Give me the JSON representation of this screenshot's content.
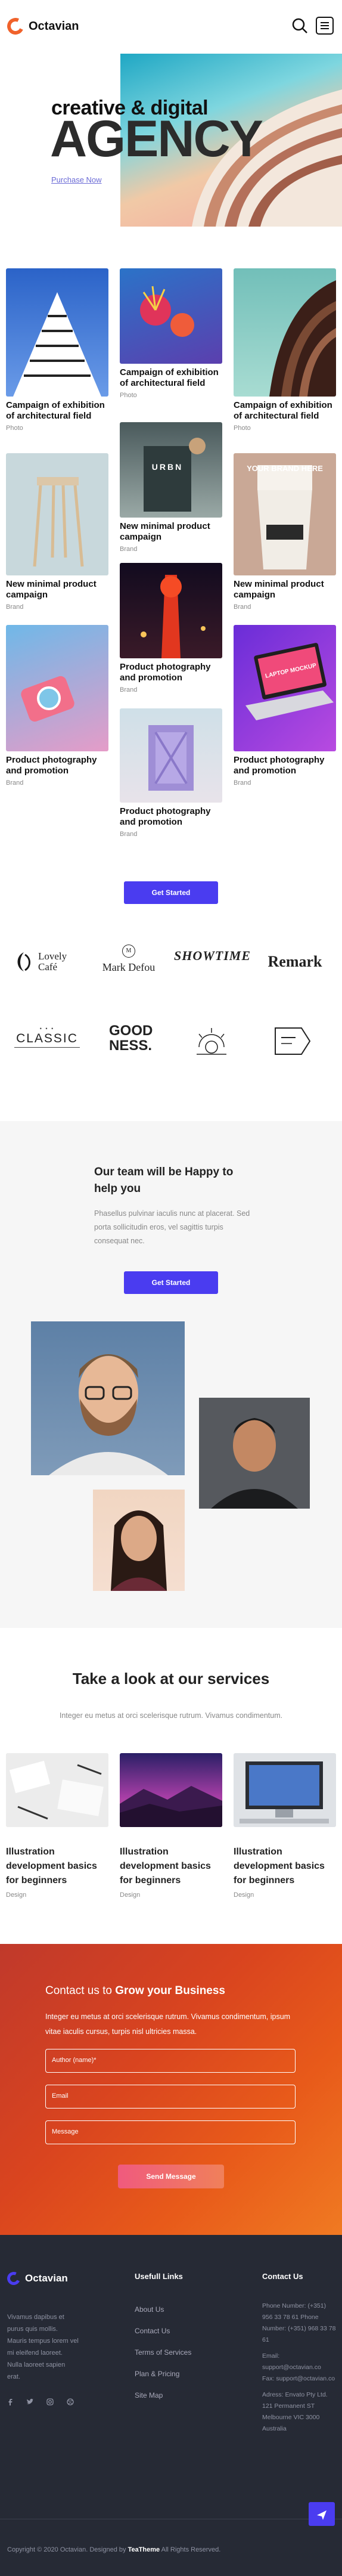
{
  "brand": {
    "name": "Octavian"
  },
  "hero": {
    "subtitle": "creative & digital",
    "title": "AGENCY",
    "link": "Purchase Now"
  },
  "portfolio": [
    {
      "title": "Campaign of exhibition of architectural field",
      "category": "Photo"
    },
    {
      "title": "Campaign of exhibition of architectural field",
      "category": "Photo"
    },
    {
      "title": "Campaign of exhibition of architectural field",
      "category": "Photo"
    },
    {
      "title": "New minimal product campaign",
      "category": "Brand"
    },
    {
      "title": "New minimal product campaign",
      "category": "Brand"
    },
    {
      "title": "New minimal product campaign",
      "category": "Brand"
    },
    {
      "title": "Product photography and promotion",
      "category": "Brand"
    },
    {
      "title": "Product photography and promotion",
      "category": "Brand"
    },
    {
      "title": "Product photography and promotion",
      "category": "Brand"
    },
    {
      "title": "Product photography and promotion",
      "category": "Brand"
    }
  ],
  "card_texts": {
    "urbn": "URBN",
    "your_brand": "YOUR BRAND HERE",
    "laptop": "LAPTOP MOCKUP"
  },
  "get_started": "Get Started",
  "brands": [
    "Lovely Café",
    "Mark Defou",
    "SHOWTIME",
    "Remark",
    "CLASSIC",
    "GOOD NESS.",
    "",
    ""
  ],
  "team": {
    "heading": "Our team will be Happy to help you",
    "text": "Phasellus pulvinar iaculis nunc at placerat. Sed porta sollicitudin eros, vel sagittis turpis consequat nec.",
    "button": "Get Started"
  },
  "services": {
    "heading": "Take a look at our services",
    "text": "Integer eu metus at orci scelerisque rutrum. Vivamus condimentum.",
    "items": [
      {
        "title": "Illustration development basics for beginners",
        "category": "Design"
      },
      {
        "title": "Illustration development basics for beginners",
        "category": "Design"
      },
      {
        "title": "Illustration development basics for beginners",
        "category": "Design"
      }
    ]
  },
  "contact": {
    "heading_pre": "Contact us to ",
    "heading_bold": "Grow your Business",
    "text": "Integer eu metus at orci scelerisque rutrum. Vivamus condimentum, ipsum vitae iaculis cursus, turpis nisl ultricies massa.",
    "author_placeholder": "Author (name)*",
    "email_placeholder": "Email",
    "message_placeholder": "Message",
    "send": "Send Message"
  },
  "footer": {
    "about": "Vivamus dapibus et purus quis mollis. Mauris tempus lorem vel mi eleifend laoreet. Nulla laoreet sapien erat.",
    "useful_title": "Usefull Links",
    "links": [
      "About Us",
      "Contact Us",
      "Terms of Services",
      "Plan & Pricing",
      "Site Map"
    ],
    "contact_title": "Contact Us",
    "contact_lines": [
      "Phone Number: (+351) 956 33 78 61 Phone Number: (+351) 968 33 78 61",
      "Email: support@octavian.co",
      "Fax: support@octavian.co",
      "Adress: Envato Pty Ltd. 121 Permanent ST Melbourne VIC 3000 Australia"
    ],
    "copyright_pre": "Copyright © 2020 Octavian. Designed by ",
    "copyright_brand": "TeaTheme",
    "copyright_post": " All Rights Reserved."
  },
  "colors": {
    "accent": "#4a3cf0",
    "orange": "#f0622b",
    "footer_bg": "#262a35"
  }
}
